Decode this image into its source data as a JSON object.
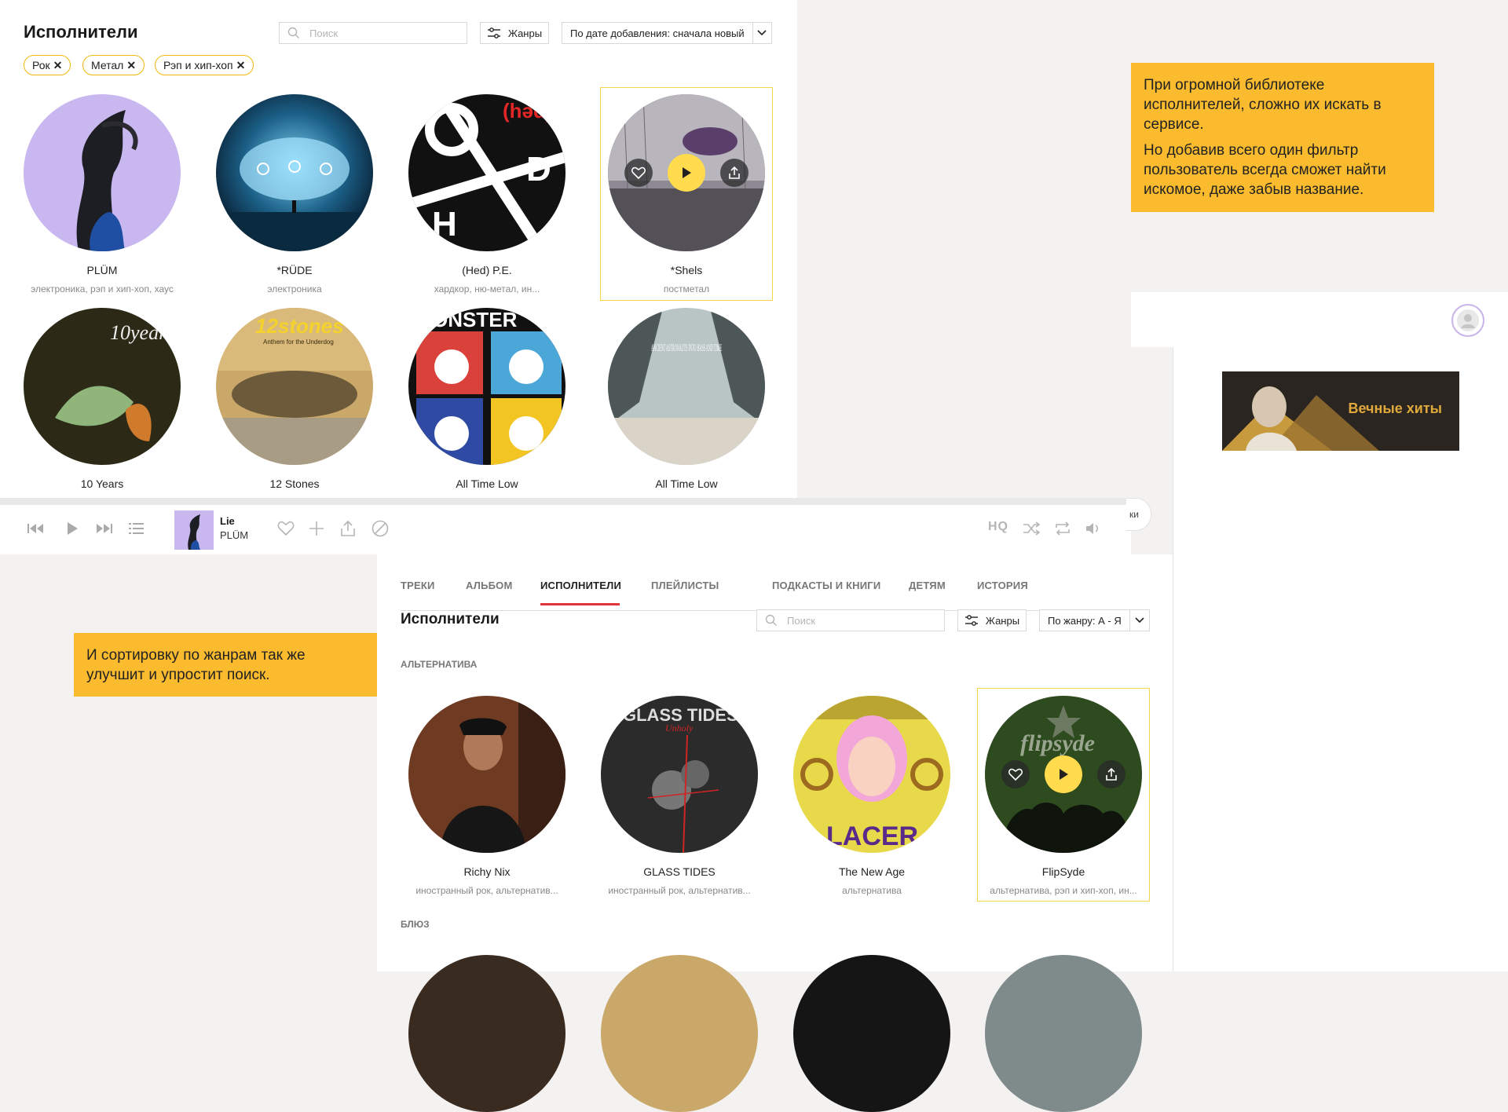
{
  "top": {
    "title": "Исполнители",
    "search_placeholder": "Поиск",
    "genres_button": "Жанры",
    "sort_label": "По дате добавления: сначала новый",
    "chips": [
      {
        "label": "Рок",
        "x": "✕"
      },
      {
        "label": "Метал",
        "x": "✕"
      },
      {
        "label": "Рэп и хип-хоп",
        "x": "✕"
      }
    ],
    "artists": [
      {
        "name": "PLÜM",
        "genre": "электроника, рэп и хип-хоп, хаус"
      },
      {
        "name": "*RÜDE",
        "genre": "электроника"
      },
      {
        "name": "(Hed) P.E.",
        "genre": "хардкор, ню-метал, ин..."
      },
      {
        "name": "*Shels",
        "genre": "постметал"
      },
      {
        "name": "10 Years",
        "genre": ""
      },
      {
        "name": "12 Stones",
        "genre": ""
      },
      {
        "name": "All Time Low",
        "genre": ""
      },
      {
        "name": "All Time Low",
        "genre": ""
      }
    ],
    "cover_texts": {
      "hed": "(həd)",
      "tenyears": "10years",
      "twelve": "12stones",
      "twelve_sub": "Anthem for the Underdog",
      "monster": "ONSTER",
      "ancient": "ANCIENT ASTRONAUTS INTO BASS AND TIME"
    }
  },
  "notes": {
    "note1_p1": "При огромной библиотеке исполнителей, сложно их искать в сервисе.",
    "note1_p2": "Но добавив всего один фильтр пользователь всегда сможет найти искомое, даже забыв название.",
    "note2": "И сортировку по жанрам так же улучшит и упростит поиск."
  },
  "banner": {
    "text": "Вечные хиты"
  },
  "player": {
    "track": "Lie",
    "artist": "PLÜM",
    "hq": "HQ",
    "tail_text": "ки"
  },
  "bottom": {
    "tabs": [
      "ТРЕКИ",
      "АЛЬБОМ",
      "ИСПОЛНИТЕЛИ",
      "ПЛЕЙЛИСТЫ",
      "ПОДКАСТЫ И КНИГИ",
      "ДЕТЯМ",
      "ИСТОРИЯ"
    ],
    "title": "Исполнители",
    "search_placeholder": "Поиск",
    "genres_button": "Жанры",
    "sort_label": "По жанру: А - Я",
    "section1": "АЛЬТЕРНАТИВА",
    "section2": "БЛЮЗ",
    "artists": [
      {
        "name": "Richy Nix",
        "genre": "иностранный рок, альтернатив..."
      },
      {
        "name": "GLASS TIDES",
        "genre": "иностранный рок, альтернатив..."
      },
      {
        "name": "The New Age",
        "genre": "альтернатива"
      },
      {
        "name": "FlipSyde",
        "genre": "альтернатива, рэп и хип-хоп, ин..."
      }
    ],
    "cover_texts": {
      "glass": "GLASS TIDES",
      "glass_sub": "Unholy",
      "newage": "LACER",
      "flipsyde": "flipsyde"
    }
  },
  "colors": {
    "accent_yellow": "#fbbb2e",
    "chip_border": "#f0b90b",
    "active_tab": "#e0353a",
    "play": "#ffdb4d"
  }
}
